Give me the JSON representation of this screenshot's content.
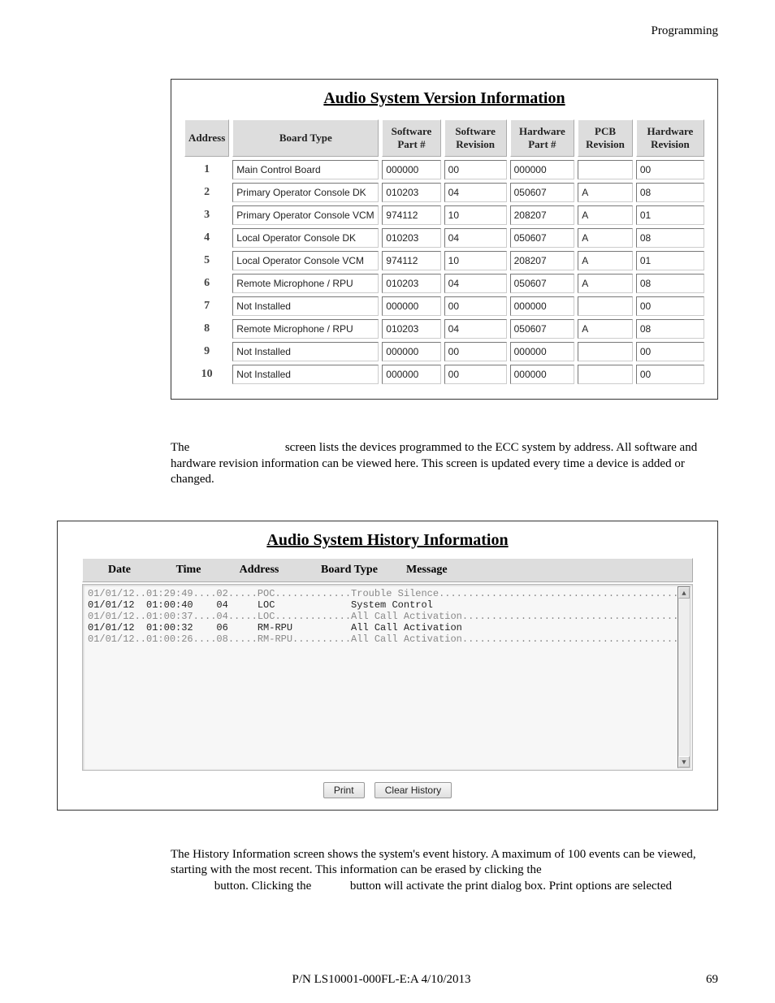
{
  "header": {
    "section": "Programming"
  },
  "version_panel": {
    "title": "Audio System Version Information",
    "columns": [
      "Address",
      "Board Type",
      "Software Part #",
      "Software Revision",
      "Hardware Part #",
      "PCB Revision",
      "Hardware Revision"
    ],
    "rows": [
      {
        "addr": "1",
        "board": "Main Control Board",
        "swpart": "000000",
        "swrev": "00",
        "hwpart": "000000",
        "pcb": "",
        "hwrev": "00"
      },
      {
        "addr": "2",
        "board": "Primary Operator Console DK",
        "swpart": "010203",
        "swrev": "04",
        "hwpart": "050607",
        "pcb": "A",
        "hwrev": "08"
      },
      {
        "addr": "3",
        "board": "Primary Operator Console VCM",
        "swpart": "974112",
        "swrev": "10",
        "hwpart": "208207",
        "pcb": "A",
        "hwrev": "01"
      },
      {
        "addr": "4",
        "board": "Local Operator Console DK",
        "swpart": "010203",
        "swrev": "04",
        "hwpart": "050607",
        "pcb": "A",
        "hwrev": "08"
      },
      {
        "addr": "5",
        "board": "Local Operator Console VCM",
        "swpart": "974112",
        "swrev": "10",
        "hwpart": "208207",
        "pcb": "A",
        "hwrev": "01"
      },
      {
        "addr": "6",
        "board": "Remote Microphone / RPU",
        "swpart": "010203",
        "swrev": "04",
        "hwpart": "050607",
        "pcb": "A",
        "hwrev": "08"
      },
      {
        "addr": "7",
        "board": "Not Installed",
        "swpart": "000000",
        "swrev": "00",
        "hwpart": "000000",
        "pcb": "",
        "hwrev": "00"
      },
      {
        "addr": "8",
        "board": "Remote Microphone / RPU",
        "swpart": "010203",
        "swrev": "04",
        "hwpart": "050607",
        "pcb": "A",
        "hwrev": "08"
      },
      {
        "addr": "9",
        "board": "Not Installed",
        "swpart": "000000",
        "swrev": "00",
        "hwpart": "000000",
        "pcb": "",
        "hwrev": "00"
      },
      {
        "addr": "10",
        "board": "Not Installed",
        "swpart": "000000",
        "swrev": "00",
        "hwpart": "000000",
        "pcb": "",
        "hwrev": "00"
      }
    ]
  },
  "para1_a": "The ",
  "para1_b": " screen lists the devices programmed to the ECC system by address.  All software and hardware revision information can be viewed here.  This screen is updated every time a device is added or changed.",
  "history_panel": {
    "title": "Audio System History Information",
    "columns": {
      "date": "Date",
      "time": "Time",
      "address": "Address",
      "board": "Board Type",
      "message": "Message"
    },
    "log": [
      {
        "date": "01/01/12",
        "time": "01:29:49",
        "addr": "02",
        "board": "POC",
        "msg": "Trouble Silence",
        "alt": true
      },
      {
        "date": "01/01/12",
        "time": "01:00:40",
        "addr": "04",
        "board": "LOC",
        "msg": "System Control",
        "alt": false
      },
      {
        "date": "01/01/12",
        "time": "01:00:37",
        "addr": "04",
        "board": "LOC",
        "msg": "All Call Activation",
        "alt": true
      },
      {
        "date": "01/01/12",
        "time": "01:00:32",
        "addr": "06",
        "board": "RM-RPU",
        "msg": "All Call Activation",
        "alt": false
      },
      {
        "date": "01/01/12",
        "time": "01:00:26",
        "addr": "08",
        "board": "RM-RPU",
        "msg": "All Call Activation",
        "alt": true
      }
    ],
    "buttons": {
      "print": "Print",
      "clear": "Clear History"
    }
  },
  "para2_a": "The History Information screen shows the system's event history.  A maximum of 100 events can be viewed, starting with the most recent.  This information can be erased by clicking the ",
  "para2_b": " button.  Clicking the ",
  "para2_c": " button will activate the print dialog box.  Print options are selected",
  "footer": {
    "left": "",
    "center": "P/N LS10001-000FL-E:A  4/10/2013",
    "right": "69"
  }
}
